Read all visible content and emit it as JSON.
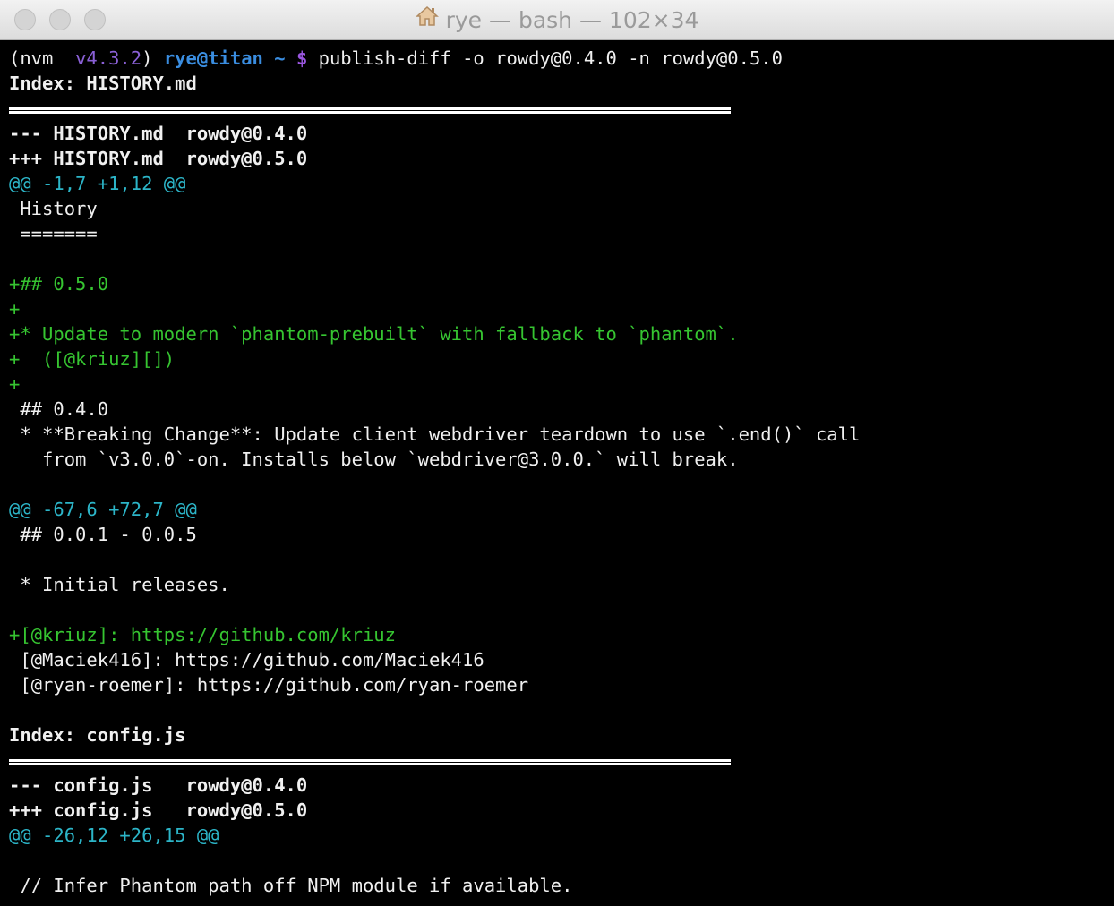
{
  "window": {
    "title": "rye — bash — 102×34"
  },
  "prompt": {
    "prefix": "(nvm  ",
    "nvm_version": "v4.3.2",
    "close_paren": ") ",
    "user_host": "rye@titan",
    "cwd": " ~ ",
    "dollar": "$ ",
    "command": "publish-diff -o rowdy@0.4.0 -n rowdy@0.5.0"
  },
  "diff1": {
    "index": "Index: HISTORY.md",
    "old_header": "--- HISTORY.md  rowdy@0.4.0",
    "new_header": "+++ HISTORY.md  rowdy@0.5.0",
    "hunk1": "@@ -1,7 +1,12 @@",
    "ctx_history": " History",
    "ctx_underline": " =======",
    "blank1": "",
    "add_version": "+## 0.5.0",
    "add_blank1": "+",
    "add_update": "+* Update to modern `phantom-prebuilt` with fallback to `phantom`.",
    "add_credit": "+  ([@kriuz][])",
    "add_blank2": "+",
    "ctx_040": " ## 0.4.0",
    "ctx_breaking": " * **Breaking Change**: Update client webdriver teardown to use `.end()` call",
    "ctx_from": "   from `v3.0.0`-on. Installs below `webdriver@3.0.0.` will break.",
    "blank2": "",
    "hunk2": "@@ -67,6 +72,7 @@",
    "ctx_001": " ## 0.0.1 - 0.0.5",
    "blank3": "",
    "ctx_initial": " * Initial releases.",
    "blank4": "",
    "add_link": "+[@kriuz]: https://github.com/kriuz",
    "ctx_maciek": " [@Maciek416]: https://github.com/Maciek416",
    "ctx_ryan": " [@ryan-roemer]: https://github.com/ryan-roemer",
    "blank5": ""
  },
  "diff2": {
    "index": "Index: config.js",
    "old_header": "--- config.js   rowdy@0.4.0",
    "new_header": "+++ config.js   rowdy@0.5.0",
    "hunk1": "@@ -26,12 +26,15 @@",
    "blank1": "",
    "ctx_comment": " // Infer Phantom path off NPM module if available."
  }
}
